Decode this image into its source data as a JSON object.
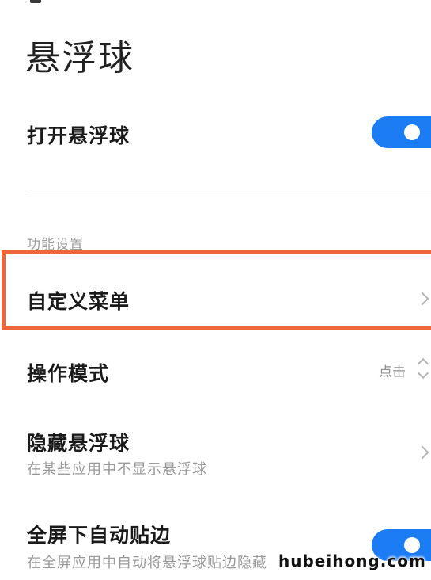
{
  "page": {
    "title": "悬浮球"
  },
  "main_toggle": {
    "label": "打开悬浮球",
    "enabled": true
  },
  "section": {
    "header": "功能设置"
  },
  "items": [
    {
      "label": "自定义菜单"
    },
    {
      "label": "操作模式",
      "value": "点击"
    },
    {
      "label": "隐藏悬浮球",
      "subtitle": "在某些应用中不显示悬浮球"
    },
    {
      "label": "全屏下自动贴边",
      "subtitle": "在全屏应用中自动将悬浮球贴边隐藏",
      "enabled": true
    }
  ],
  "watermark": {
    "text": "hubeihong.com"
  },
  "colors": {
    "accent": "#1c7cf4",
    "highlight": "#f0663c",
    "secondary_text": "#9a9a9a"
  }
}
